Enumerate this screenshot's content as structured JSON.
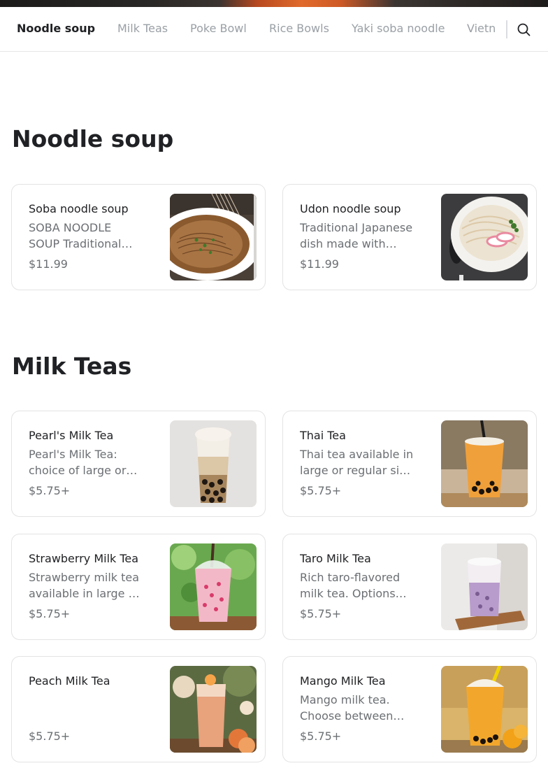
{
  "header": {
    "categories": [
      {
        "label": "Noodle soup",
        "active": true
      },
      {
        "label": "Milk Teas",
        "active": false
      },
      {
        "label": "Poke Bowl",
        "active": false
      },
      {
        "label": "Rice Bowls",
        "active": false
      },
      {
        "label": "Yaki soba noodle",
        "active": false
      },
      {
        "label": "Vietn",
        "active": false
      }
    ],
    "search_icon": "search-icon"
  },
  "sections": [
    {
      "title": "Noodle soup",
      "items": [
        {
          "name": "Soba noodle soup",
          "description": "SOBA NOODLE SOUP Traditional…",
          "price": "$11.99",
          "image": "soba-noodle-soup-photo"
        },
        {
          "name": "Udon noodle soup",
          "description": "Traditional Japanese dish made with…",
          "price": "$11.99",
          "image": "udon-noodle-soup-photo"
        }
      ]
    },
    {
      "title": "Milk Teas",
      "items": [
        {
          "name": "Pearl's Milk Tea",
          "description": "Pearl's Milk Tea: choice of large or…",
          "price": "$5.75+",
          "image": "pearls-milk-tea-photo"
        },
        {
          "name": "Thai Tea",
          "description": "Thai tea available in large or regular si…",
          "price": "$5.75+",
          "image": "thai-tea-photo"
        },
        {
          "name": "Strawberry Milk Tea",
          "description": "Strawberry milk tea available in large …",
          "price": "$5.75+",
          "image": "strawberry-milk-tea-photo"
        },
        {
          "name": "Taro Milk Tea",
          "description": "Rich taro-flavored milk tea. Options…",
          "price": "$5.75+",
          "image": "taro-milk-tea-photo"
        },
        {
          "name": "Peach Milk Tea",
          "description": "",
          "price": "$5.75+",
          "image": "peach-milk-tea-photo"
        },
        {
          "name": "Mango Milk Tea",
          "description": "Mango milk tea. Choose between…",
          "price": "$5.75+",
          "image": "mango-milk-tea-photo"
        }
      ]
    }
  ]
}
